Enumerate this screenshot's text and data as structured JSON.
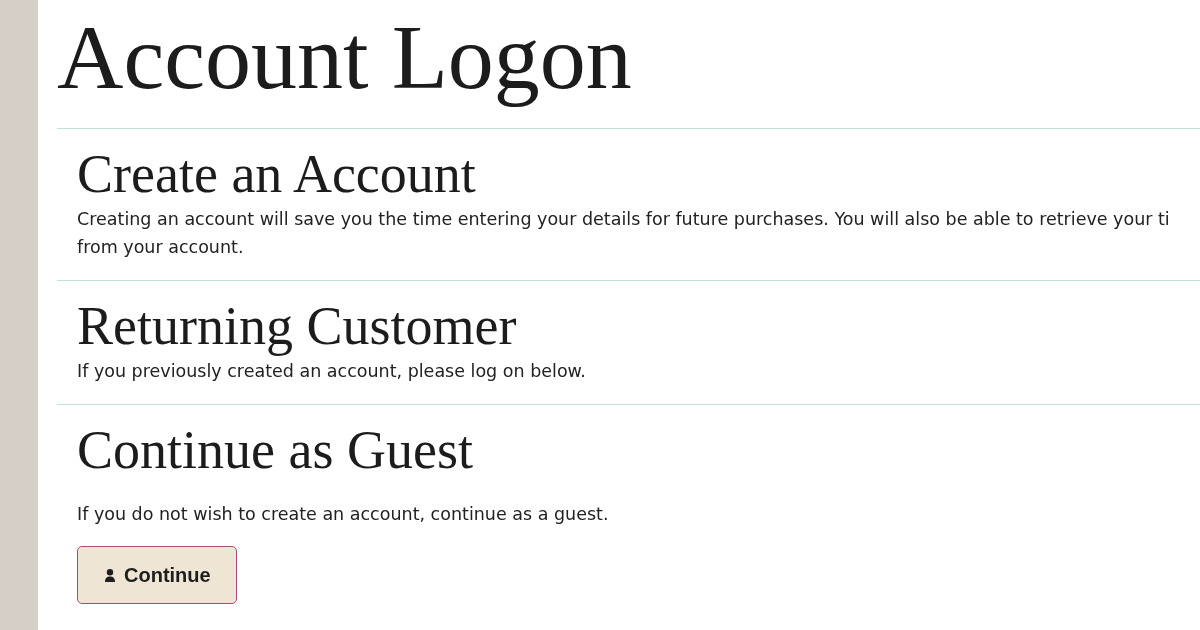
{
  "page": {
    "title": "Account Logon"
  },
  "sections": [
    {
      "kind": "info",
      "heading": "Create an Account",
      "lines": [
        "Creating an account will save you the time entering your details for future purchases. You will also be able to retrieve your ti",
        "from your account."
      ]
    },
    {
      "kind": "info",
      "heading": "Returning Customer",
      "lines": [
        "If you previously created an account, please log on below."
      ]
    },
    {
      "kind": "action",
      "heading": "Continue as Guest",
      "lines": [
        "If you do not wish to create an account, continue as a guest."
      ],
      "button": {
        "label": "Continue"
      }
    }
  ]
}
